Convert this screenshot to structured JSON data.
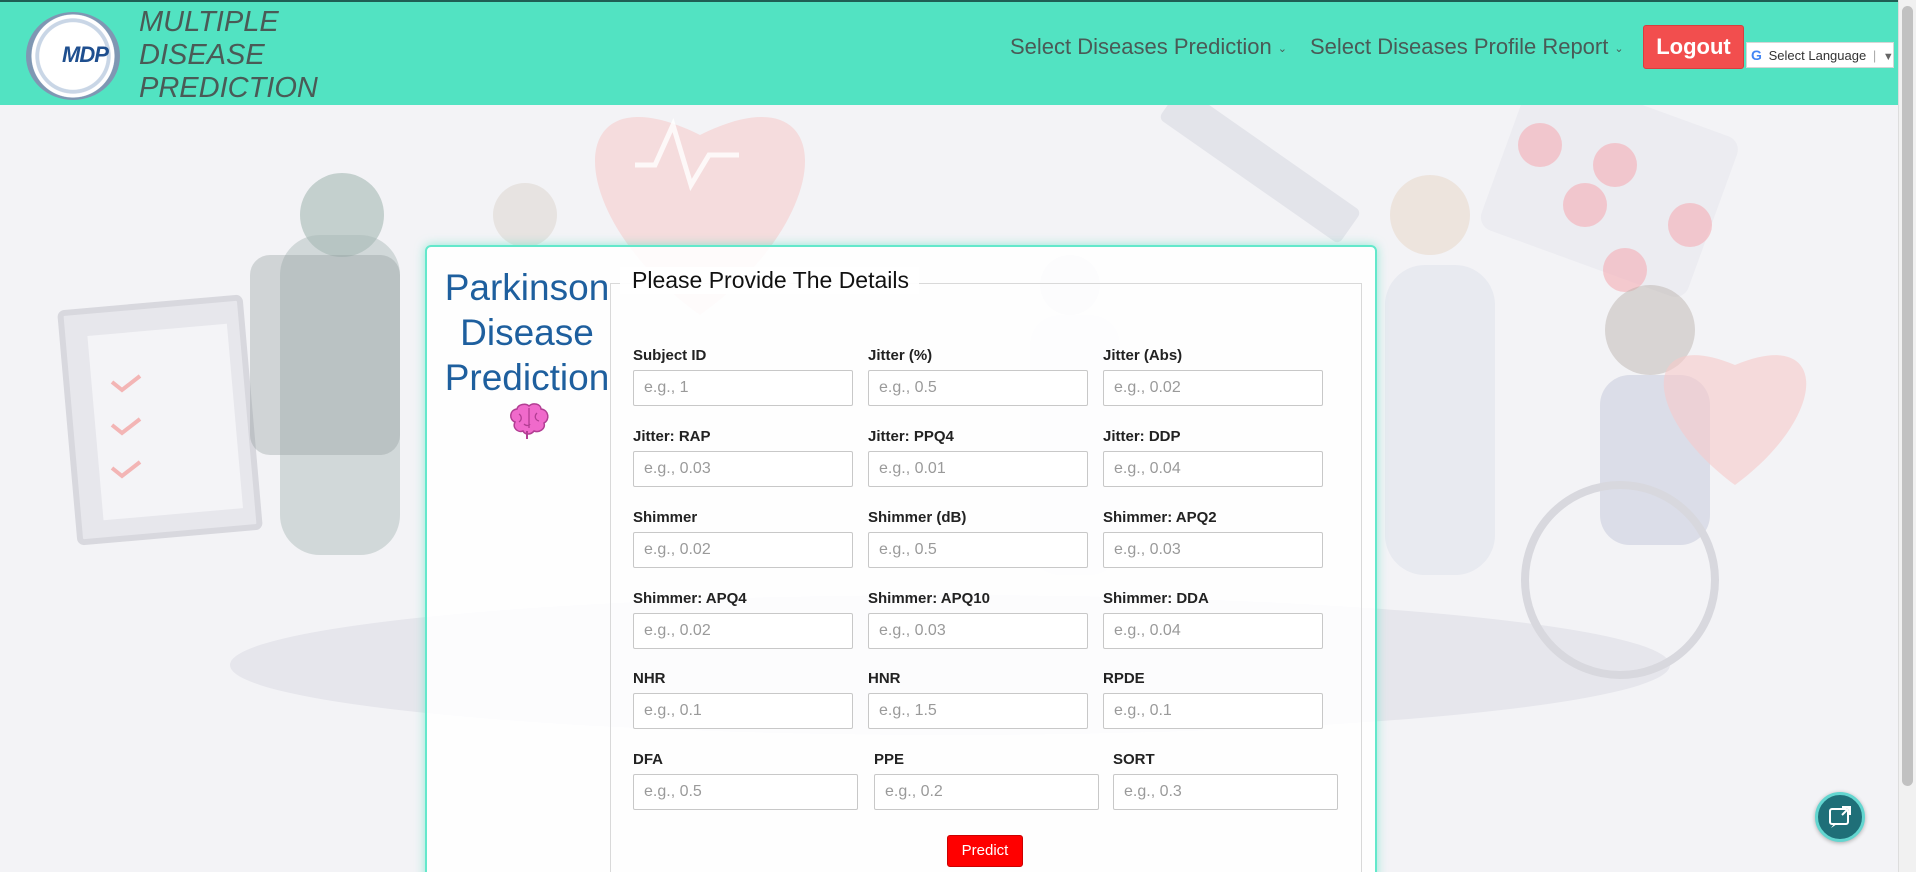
{
  "brand": {
    "line1": "MULTIPLE",
    "line2": "DISEASE",
    "line3": "PREDICTION",
    "logo_text": "MDP"
  },
  "nav": {
    "disease_prediction": "Select Diseases Prediction",
    "profile_report": "Select Diseases Profile Report",
    "logout": "Logout",
    "language": "Select Language"
  },
  "page": {
    "title_line1": "Parkinson",
    "title_line2": "Disease",
    "title_line3": "Prediction",
    "legend": "Please Provide The Details",
    "predict": "Predict"
  },
  "fields": [
    {
      "label": "Subject ID",
      "placeholder": "e.g., 1"
    },
    {
      "label": "Jitter (%)",
      "placeholder": "e.g., 0.5"
    },
    {
      "label": "Jitter (Abs)",
      "placeholder": "e.g., 0.02"
    },
    {
      "label": "Jitter: RAP",
      "placeholder": "e.g., 0.03"
    },
    {
      "label": "Jitter: PPQ4",
      "placeholder": "e.g., 0.01"
    },
    {
      "label": "Jitter: DDP",
      "placeholder": "e.g., 0.04"
    },
    {
      "label": "Shimmer",
      "placeholder": "e.g., 0.02"
    },
    {
      "label": "Shimmer (dB)",
      "placeholder": "e.g., 0.5"
    },
    {
      "label": "Shimmer: APQ2",
      "placeholder": "e.g., 0.03"
    },
    {
      "label": "Shimmer: APQ4",
      "placeholder": "e.g., 0.02"
    },
    {
      "label": "Shimmer: APQ10",
      "placeholder": "e.g., 0.03"
    },
    {
      "label": "Shimmer: DDA",
      "placeholder": "e.g., 0.04"
    },
    {
      "label": "NHR",
      "placeholder": "e.g., 0.1"
    },
    {
      "label": "HNR",
      "placeholder": "e.g., 1.5"
    },
    {
      "label": "RPDE",
      "placeholder": "e.g., 0.1"
    },
    {
      "label": "DFA",
      "placeholder": "e.g., 0.5"
    },
    {
      "label": "PPE",
      "placeholder": "e.g., 0.2"
    },
    {
      "label": "SORT",
      "placeholder": "e.g., 0.3"
    }
  ],
  "icons": {
    "brain": "brain-icon",
    "chat": "chat-icon",
    "google": "google-icon"
  },
  "colors": {
    "navbar": "#52e3c2",
    "logout": "#f24e4e",
    "predict": "#ff0000",
    "title": "#1e5f9e"
  }
}
